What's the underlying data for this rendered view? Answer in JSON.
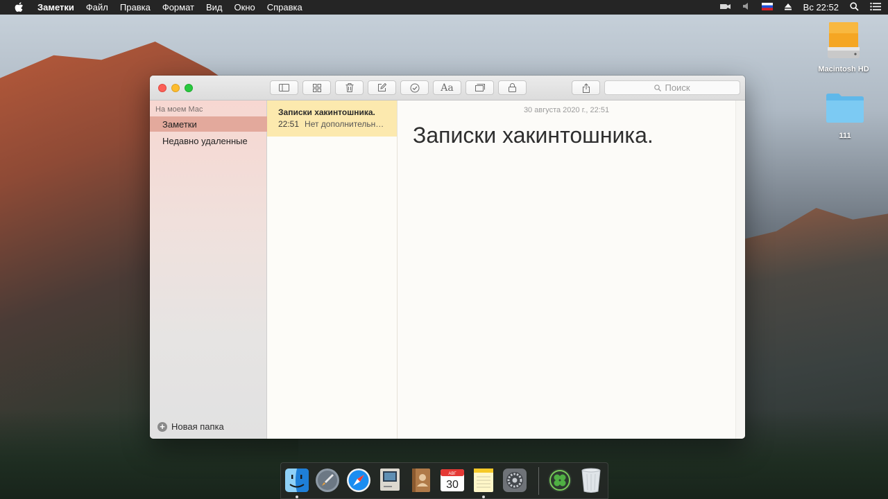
{
  "menubar": {
    "app_name": "Заметки",
    "items": [
      "Файл",
      "Правка",
      "Формат",
      "Вид",
      "Окно",
      "Справка"
    ],
    "clock": "Вс 22:52"
  },
  "desktop": {
    "icons": [
      {
        "label": "Macintosh HD",
        "icon": "hard-drive-icon"
      },
      {
        "label": "111",
        "icon": "folder-icon"
      }
    ]
  },
  "window": {
    "search_placeholder": "Поиск",
    "sidebar": {
      "header": "На моем Mac",
      "items": [
        {
          "label": "Заметки",
          "selected": true
        },
        {
          "label": "Недавно удаленные",
          "selected": false
        }
      ],
      "new_folder": "Новая папка"
    },
    "notes": [
      {
        "title": "Записки хакинтошника.",
        "time": "22:51",
        "preview": "Нет дополнительного текста"
      }
    ],
    "editor": {
      "date": "30 августа 2020 г., 22:51",
      "heading": "Записки хакинтошника."
    }
  },
  "dock": {
    "calendar": {
      "month": "АВГ",
      "day": "30"
    }
  },
  "colors": {
    "sidebar_selected": "#e3a99c",
    "note_selected": "#fce9ae",
    "menubar": "#252525"
  }
}
